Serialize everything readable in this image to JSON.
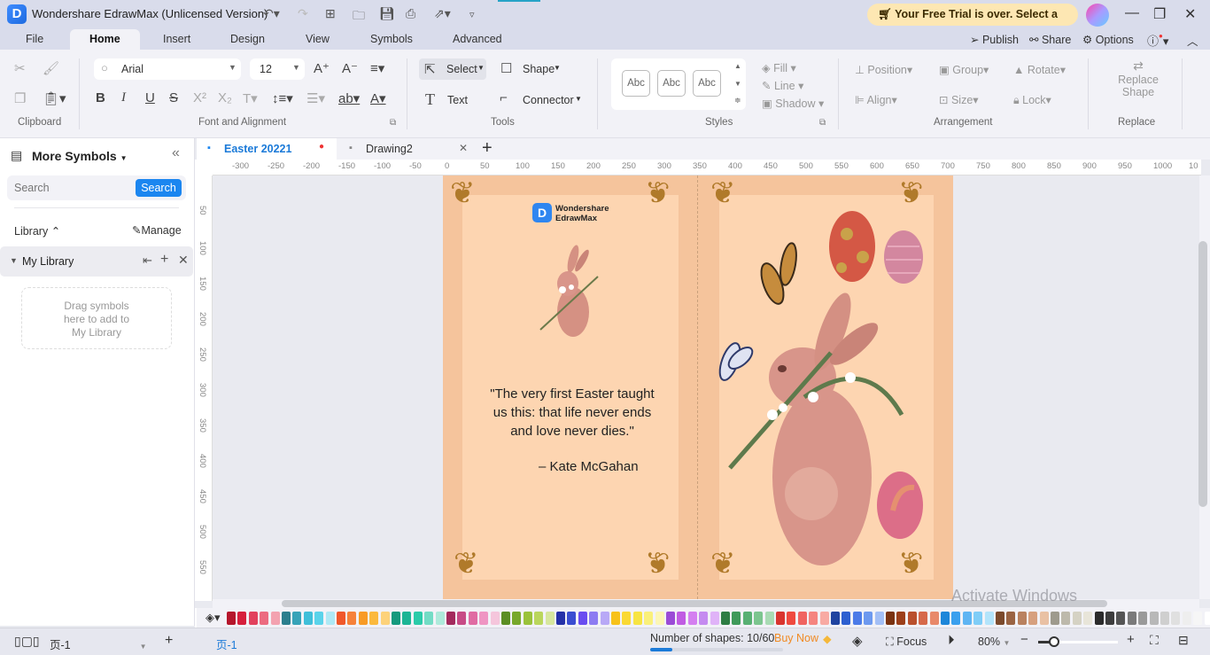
{
  "app": {
    "title": "Wondershare EdrawMax (Unlicensed Version)",
    "trial_banner": "Your Free Trial is over. Select a Plan"
  },
  "menu": {
    "tabs": [
      "File",
      "Home",
      "Insert",
      "Design",
      "View",
      "Symbols",
      "Advanced"
    ],
    "active_tab": "Home",
    "right": {
      "publish": "Publish",
      "share": "Share",
      "options": "Options"
    }
  },
  "ribbon": {
    "clipboard": {
      "label": "Clipboard"
    },
    "font": {
      "label": "Font and Alignment",
      "family": "Arial",
      "size": "12"
    },
    "tools": {
      "label": "Tools",
      "select": "Select",
      "shape": "Shape",
      "text": "Text",
      "connector": "Connector"
    },
    "styles": {
      "label": "Styles",
      "swatches": [
        "Abc",
        "Abc",
        "Abc"
      ],
      "fill": "Fill",
      "line": "Line",
      "shadow": "Shadow"
    },
    "arrangement": {
      "label": "Arrangement",
      "position": "Position",
      "group": "Group",
      "rotate": "Rotate",
      "align": "Align",
      "size": "Size",
      "lock": "Lock"
    },
    "replace": {
      "label": "Replace",
      "button_line1": "Replace",
      "button_line2": "Shape"
    }
  },
  "sidebar": {
    "title": "More Symbols",
    "search_placeholder": "Search",
    "search_button": "Search",
    "library_label": "Library",
    "manage_label": "Manage",
    "my_library": "My Library",
    "drop_hint_1": "Drag symbols",
    "drop_hint_2": "here to add to",
    "drop_hint_3": "My Library"
  },
  "doc_tabs": [
    {
      "label": "Easter 20221",
      "active": true,
      "unsaved": true
    },
    {
      "label": "Drawing2",
      "active": false
    }
  ],
  "rulers": {
    "h": [
      "-300",
      "-250",
      "-200",
      "-150",
      "-100",
      "-50",
      "0",
      "50",
      "100",
      "150",
      "200",
      "250",
      "300",
      "350",
      "400",
      "450",
      "500",
      "550",
      "600",
      "650",
      "700",
      "750",
      "800",
      "850",
      "900",
      "950",
      "1000",
      "10"
    ],
    "v": [
      "50",
      "100",
      "150",
      "200",
      "250",
      "300",
      "350",
      "400",
      "450",
      "500",
      "550"
    ]
  },
  "card": {
    "brand_line1": "Wondershare",
    "brand_line2": "EdrawMax",
    "quote_1": "\"The very first Easter taught",
    "quote_2": "us this: that life never ends",
    "quote_3": "and love never dies.\"",
    "author": "– Kate McGahan"
  },
  "palette": [
    "#b5162b",
    "#d61f3c",
    "#e2415d",
    "#ec6b80",
    "#f3a2b0",
    "#2b7f8e",
    "#37a3b8",
    "#40bfd9",
    "#5ad3ea",
    "#aee9f5",
    "#f0582a",
    "#f6823a",
    "#f89b25",
    "#fbb93d",
    "#fdd27a",
    "#159a7e",
    "#1cb595",
    "#2bcba9",
    "#73dcc5",
    "#aeeadb",
    "#a32a5d",
    "#c74b86",
    "#e06ba3",
    "#ef95c3",
    "#f5c6dc",
    "#5b8e23",
    "#78a82b",
    "#9ac23b",
    "#bad65c",
    "#d7e79e",
    "#2531a8",
    "#3b4ed1",
    "#6a4df0",
    "#8d7cf2",
    "#b8a9f6",
    "#f7c21a",
    "#fad934",
    "#f7e443",
    "#faf07a",
    "#fcf6b5",
    "#9b4bd6",
    "#c05ce3",
    "#d47ff0",
    "#c58bf0",
    "#e0b3f8",
    "#2e7d44",
    "#3f9a5a",
    "#58b073",
    "#7cc58f",
    "#a9dbb4",
    "#d9352f",
    "#ef4a3f",
    "#f06461",
    "#f58580",
    "#f8aaa3",
    "#1f43a0",
    "#2d5fd0",
    "#4c7be8",
    "#6d99ef",
    "#a3bff6",
    "#7a3210",
    "#9c3f1a",
    "#b9502d",
    "#d6694a",
    "#e8896a",
    "#1d86d9",
    "#3aa0ee",
    "#5fb5f3",
    "#7fcdf7",
    "#b3e4fb",
    "#7b4a2c",
    "#9a6443",
    "#b9825f",
    "#d6a07e",
    "#e9c1a4",
    "#9e9a8d",
    "#bdb9ab",
    "#d5d2c4",
    "#e8e5d9",
    "#2b2b2b",
    "#3d3d3d",
    "#555555",
    "#7a7a7a",
    "#9a9a9a",
    "#b8b8b8",
    "#cfcfcf",
    "#e0e0e0",
    "#eeeeee",
    "#f6f6f6",
    "#ffffff"
  ],
  "status": {
    "page_select": "页-1",
    "page_tab": "页-1",
    "shapes": "Number of shapes: 10/60",
    "shapes_fraction": 0.1667,
    "buy_now": "Buy Now",
    "focus": "Focus",
    "zoom": "80%",
    "zoom_fraction": 0.2
  },
  "watermark": "Activate Windows"
}
